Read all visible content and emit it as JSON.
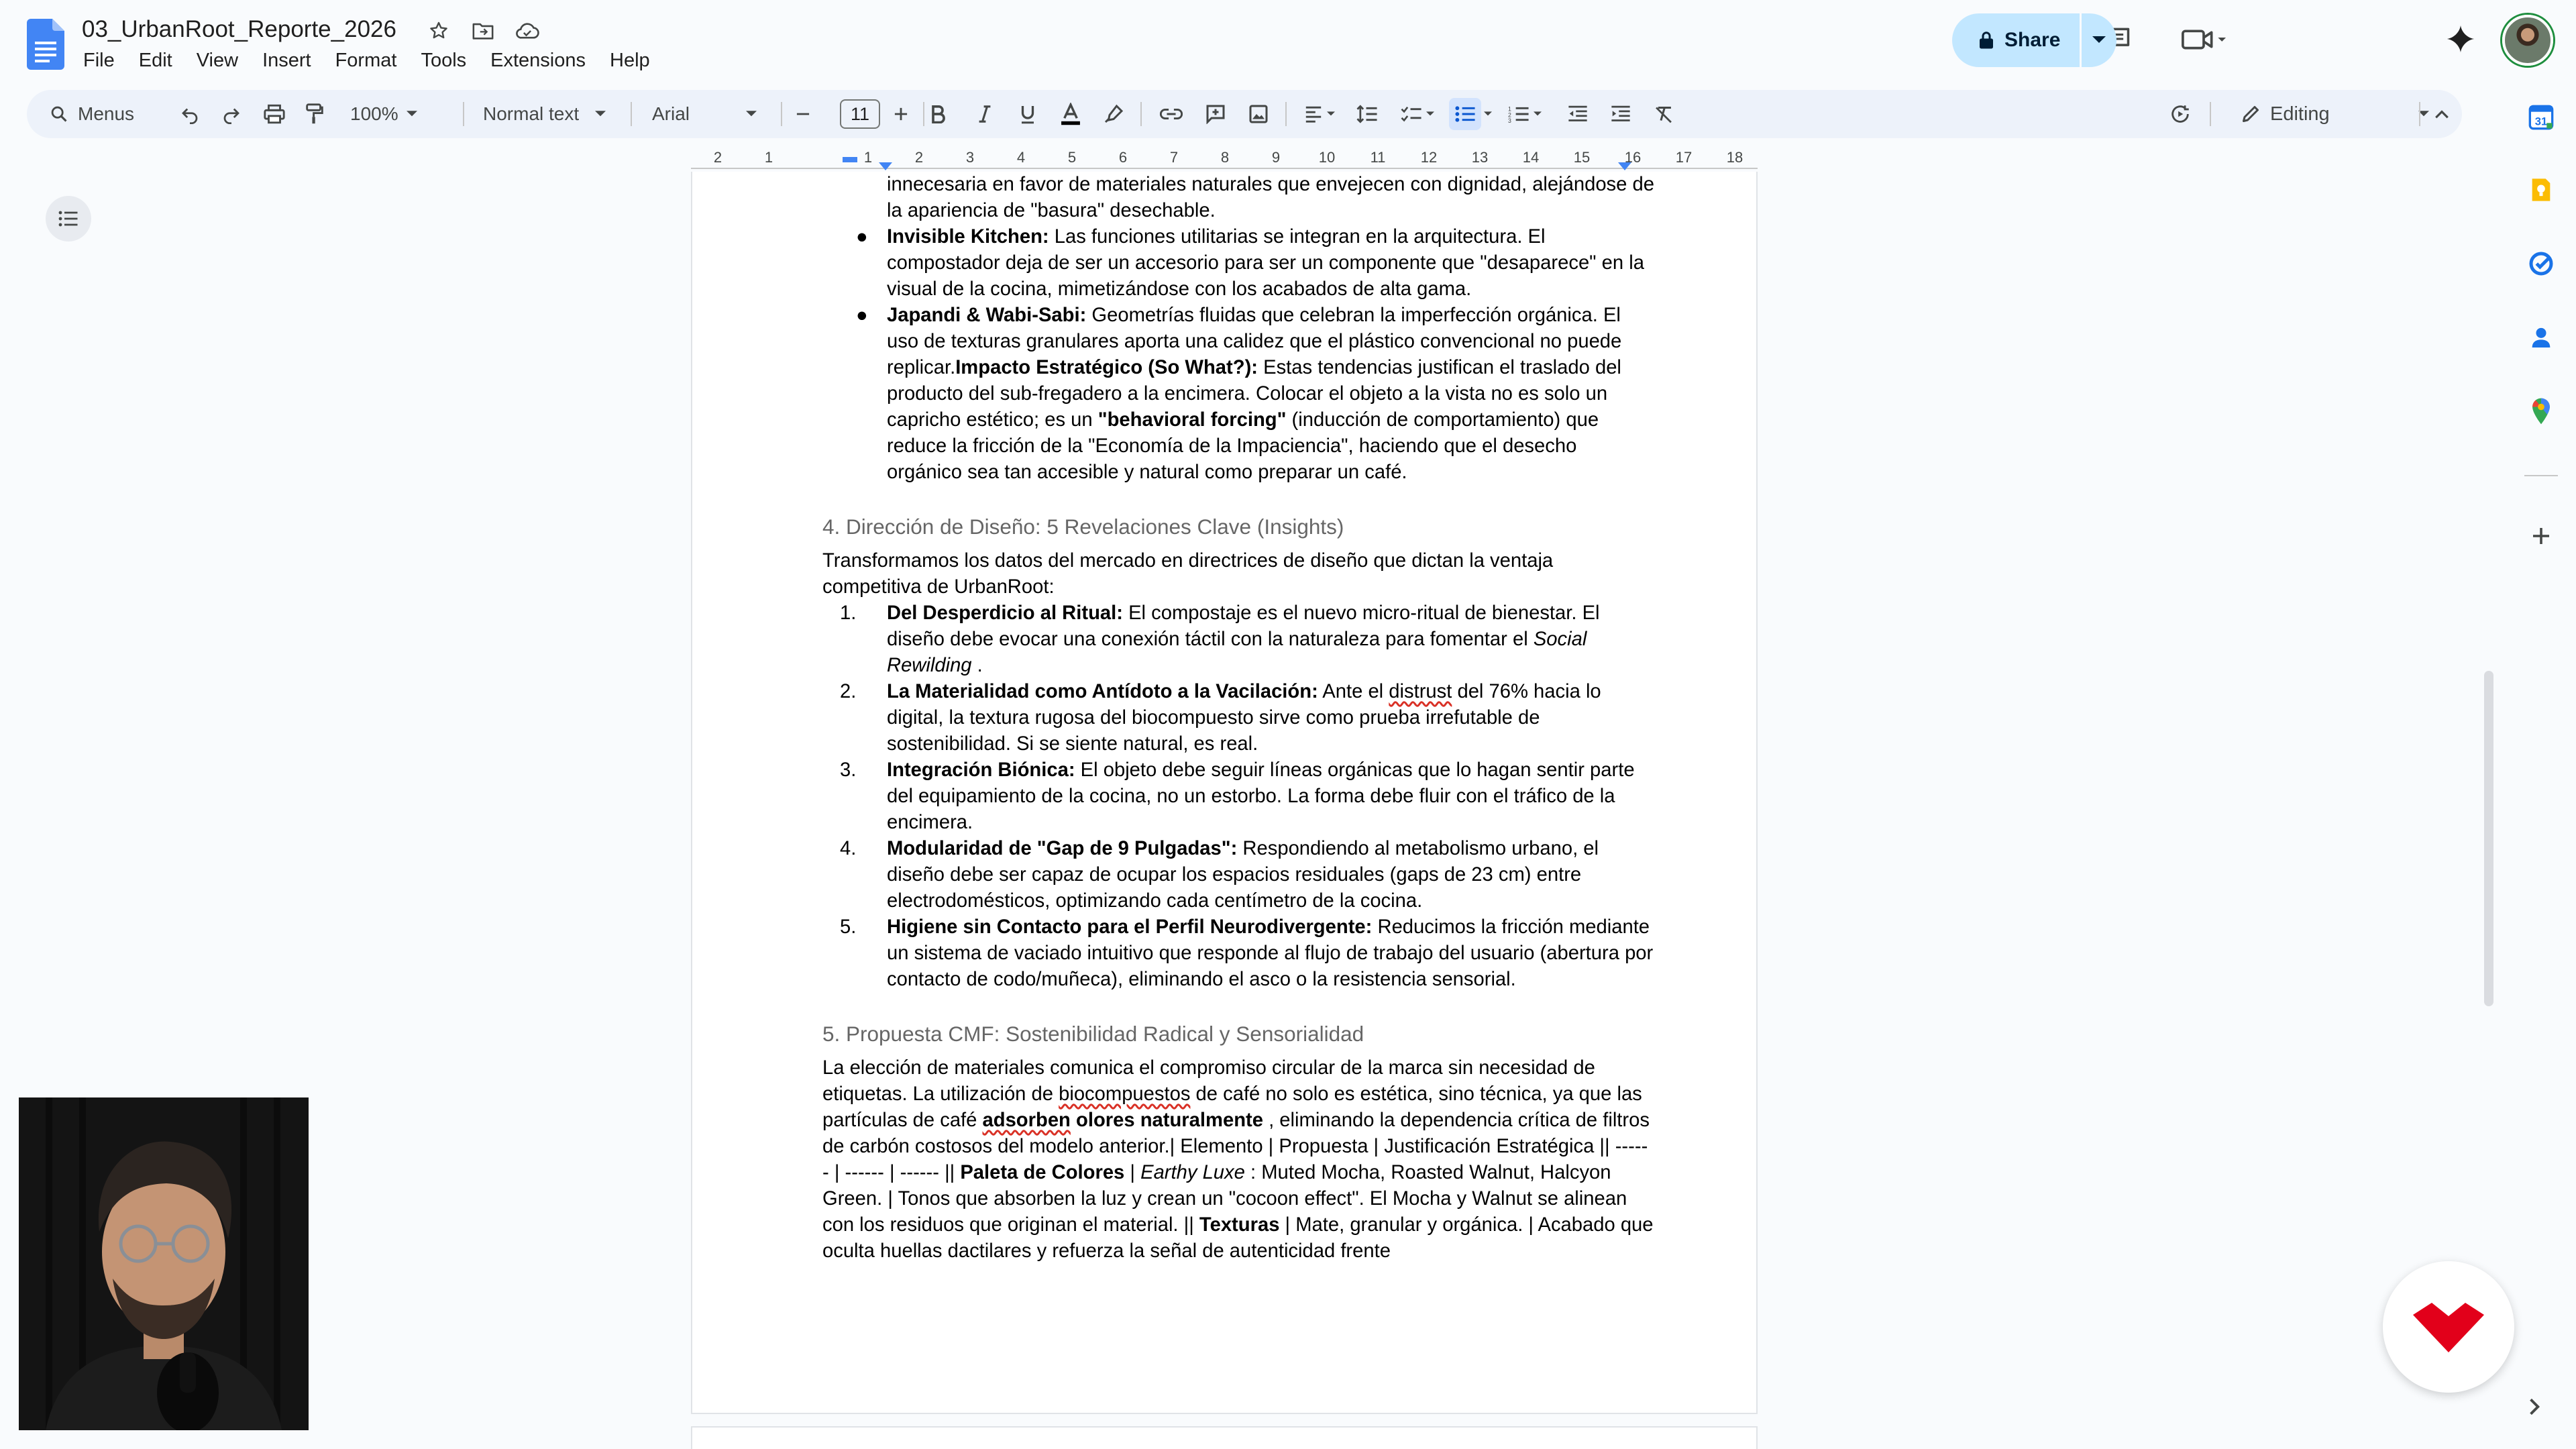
{
  "app": {
    "doc_title": "03_UrbanRoot_Reporte_2026",
    "menu": [
      "File",
      "Edit",
      "View",
      "Insert",
      "Format",
      "Tools",
      "Extensions",
      "Help"
    ],
    "share_label": "Share"
  },
  "toolbar": {
    "search_label": "Menus",
    "zoom": "100%",
    "style": "Normal text",
    "font": "Arial",
    "font_size": "11",
    "mode": "Editing"
  },
  "ruler": [
    "2",
    "1",
    "1",
    "2",
    "3",
    "4",
    "5",
    "6",
    "7",
    "8",
    "9",
    "10",
    "11",
    "12",
    "13",
    "14",
    "15",
    "16",
    "17",
    "18"
  ],
  "doc": {
    "bullets": [
      {
        "segments": [
          {
            "t": "innecesaria en favor de materiales naturales que envejecen con dignidad, alejándose de la apariencia de \"basura\" desechable."
          }
        ],
        "continuation": true
      },
      {
        "segments": [
          {
            "t": "Invisible Kitchen:",
            "b": true
          },
          {
            "t": "  Las funciones utilitarias se integran en la arquitectura. El compostador deja de ser un accesorio para ser un componente que \"desaparece\" en la visual de la cocina, mimetizándose con los acabados de alta gama."
          }
        ]
      },
      {
        "segments": [
          {
            "t": "Japandi & Wabi-Sabi:",
            "b": true
          },
          {
            "t": "  Geometrías fluidas que celebran la imperfección orgánica. El uso de texturas granulares aporta una calidez que el plástico convencional no puede replicar."
          },
          {
            "t": "Impacto Estratégico (So What?):",
            "b": true
          },
          {
            "t": "  Estas tendencias justifican el traslado del producto del sub-fregadero a la encimera. Colocar el objeto a la vista no es solo un capricho estético; es un  "
          },
          {
            "t": "\"behavioral forcing\"",
            "b": true
          },
          {
            "t": "  (inducción de comportamiento) que reduce la fricción de la \"Economía de la Impaciencia\", haciendo que el desecho orgánico sea tan accesible y natural como preparar un café."
          }
        ]
      }
    ],
    "heading4": "4. Dirección de Diseño: 5 Revelaciones Clave (Insights)",
    "intro4": "Transformamos los datos del mercado en directrices de diseño que dictan la ventaja competitiva de UrbanRoot:",
    "numbered": [
      {
        "num": "1.",
        "segments": [
          {
            "t": "Del Desperdicio al Ritual:",
            "b": true
          },
          {
            "t": "  El compostaje es el nuevo micro-ritual de bienestar. El diseño debe evocar una conexión táctil con la naturaleza para fomentar el  "
          },
          {
            "t": "Social Rewilding",
            "i": true
          },
          {
            "t": " ."
          }
        ]
      },
      {
        "num": "2.",
        "segments": [
          {
            "t": "La Materialidad como Antídoto a la Vacilación:",
            "b": true
          },
          {
            "t": " Ante el "
          },
          {
            "t": "distrust",
            "w": true
          },
          {
            "t": " del 76% hacia lo digital, la textura rugosa del biocompuesto sirve como prueba irrefutable de sostenibilidad. Si se siente natural, es real."
          }
        ]
      },
      {
        "num": "3.",
        "segments": [
          {
            "t": "Integración Biónica:",
            "b": true
          },
          {
            "t": "  El objeto debe seguir líneas orgánicas que lo hagan sentir parte del equipamiento de la cocina, no un estorbo. La forma debe fluir con el tráfico de la encimera."
          }
        ]
      },
      {
        "num": "4.",
        "segments": [
          {
            "t": "Modularidad de \"Gap de 9 Pulgadas\":",
            "b": true
          },
          {
            "t": "  Respondiendo al metabolismo urbano, el diseño debe ser capaz de ocupar los espacios residuales (gaps de 23 cm) entre electrodomésticos, optimizando cada centímetro de la cocina."
          }
        ]
      },
      {
        "num": "5.",
        "segments": [
          {
            "t": "Higiene sin Contacto para el Perfil Neurodivergente:",
            "b": true
          },
          {
            "t": "  Reducimos la fricción mediante un sistema de vaciado intuitivo que responde al flujo de trabajo del usuario (abertura por contacto de codo/muñeca), eliminando el asco o la resistencia sensorial."
          }
        ]
      }
    ],
    "heading5": "5. Propuesta CMF: Sostenibilidad Radical y Sensorialidad",
    "para5": [
      {
        "t": "La elección de materiales comunica el compromiso circular de la marca sin necesidad de etiquetas. La utilización de "
      },
      {
        "t": "biocompuestos",
        "w": true
      },
      {
        "t": " de café no solo es estética, sino técnica, ya que las partículas de café  "
      },
      {
        "t": "adsorben",
        "b": true,
        "w": true
      },
      {
        "t": " olores naturalmente",
        "b": true
      },
      {
        "t": " , eliminando la dependencia crítica de filtros de carbón costosos del modelo anterior.| Elemento | Propuesta | Justificación Estratégica || ------ | ------ | ------ || "
      },
      {
        "t": "Paleta de Colores",
        "b": true
      },
      {
        "t": " | "
      },
      {
        "t": "Earthy Luxe",
        "i": true
      },
      {
        "t": " : Muted Mocha, Roasted Walnut, Halcyon Green. | Tonos que absorben la luz y crean un \"cocoon effect\". El Mocha y Walnut se alinean con los residuos que originan el material. || "
      },
      {
        "t": "Texturas",
        "b": true
      },
      {
        "t": " | Mate, granular y orgánica. | Acabado que oculta huellas dactilares y refuerza la señal de autenticidad frente"
      }
    ]
  },
  "colors": {
    "accent": "#0b57d0",
    "share_bg": "#c2e7ff",
    "toolbar_bg": "#edf2fa",
    "heading_grey": "#666666",
    "brand_red": "#e2001a"
  }
}
